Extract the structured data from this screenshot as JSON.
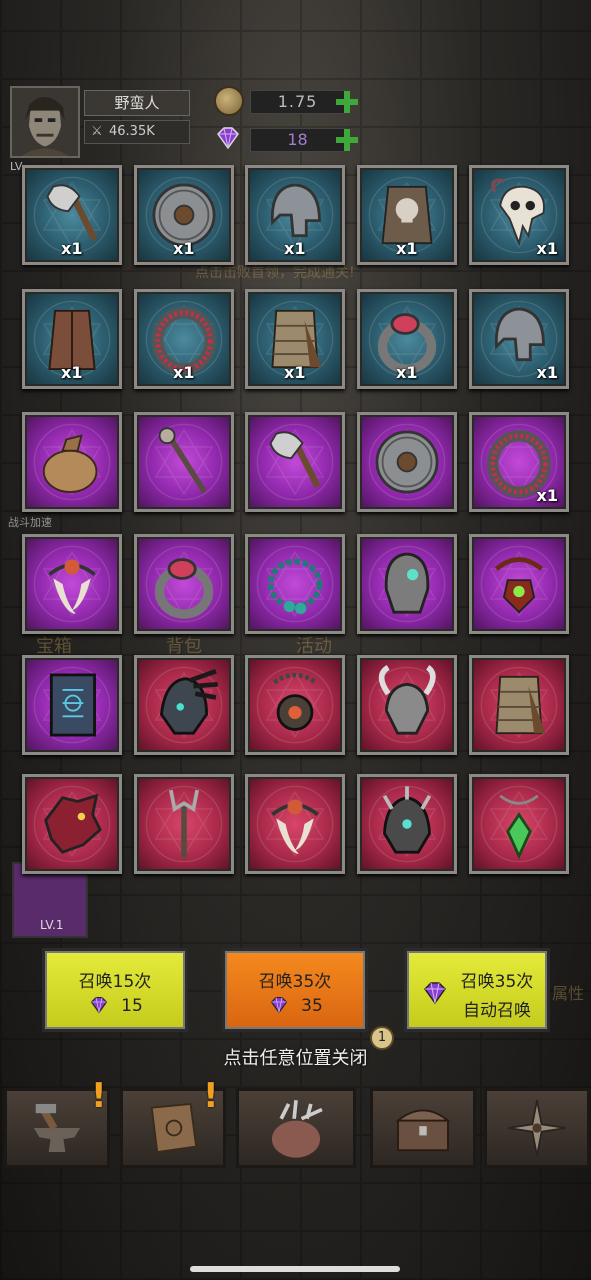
{
  "player": {
    "name": "野蛮人",
    "power": "46.35K",
    "level_prefix": "LV"
  },
  "currency": {
    "gold": "1.75",
    "gems": "18"
  },
  "background_text": {
    "hint": "点击击败首领，完成通关!",
    "tab1": "宝箱",
    "tab2": "背包",
    "tab3": "活动",
    "battle_speed": "战斗加速",
    "attr": "属性",
    "slot_level": "LV.1"
  },
  "items": [
    {
      "name": "axe",
      "rarity": "blue",
      "count": "x1"
    },
    {
      "name": "round-shield",
      "rarity": "blue",
      "count": "x1"
    },
    {
      "name": "iron-helmet",
      "rarity": "blue",
      "count": "x1"
    },
    {
      "name": "barbarian-chest-armor",
      "rarity": "blue",
      "count": "x1"
    },
    {
      "name": "skull-helmet",
      "rarity": "blue",
      "count": "x1"
    },
    {
      "name": "leather-vest",
      "rarity": "blue",
      "count": "x1"
    },
    {
      "name": "studded-ring",
      "rarity": "blue",
      "count": "x1"
    },
    {
      "name": "scale-armor",
      "rarity": "blue",
      "count": "x1"
    },
    {
      "name": "gem-ring",
      "rarity": "blue",
      "count": "x1"
    },
    {
      "name": "iron-helmet",
      "rarity": "blue",
      "count": "x1"
    },
    {
      "name": "loot-sack",
      "rarity": "purple",
      "count": ""
    },
    {
      "name": "staff",
      "rarity": "purple",
      "count": ""
    },
    {
      "name": "axe",
      "rarity": "purple",
      "count": ""
    },
    {
      "name": "round-shield",
      "rarity": "purple",
      "count": ""
    },
    {
      "name": "studded-ring",
      "rarity": "purple",
      "count": "x1"
    },
    {
      "name": "fang-necklace",
      "rarity": "purple",
      "count": ""
    },
    {
      "name": "gem-ring",
      "rarity": "purple",
      "count": ""
    },
    {
      "name": "bead-necklace",
      "rarity": "purple",
      "count": ""
    },
    {
      "name": "ornate-helmet",
      "rarity": "purple",
      "count": ""
    },
    {
      "name": "thorn-amulet",
      "rarity": "purple",
      "count": ""
    },
    {
      "name": "spell-book",
      "rarity": "purple",
      "count": ""
    },
    {
      "name": "feathered-helm",
      "rarity": "red",
      "count": ""
    },
    {
      "name": "chain-amulet",
      "rarity": "red",
      "count": ""
    },
    {
      "name": "horned-helmet",
      "rarity": "red",
      "count": ""
    },
    {
      "name": "scale-armor",
      "rarity": "red",
      "count": ""
    },
    {
      "name": "dragon-helm",
      "rarity": "red",
      "count": ""
    },
    {
      "name": "trident-staff",
      "rarity": "red",
      "count": ""
    },
    {
      "name": "fang-necklace",
      "rarity": "red",
      "count": ""
    },
    {
      "name": "spiked-helmet",
      "rarity": "red",
      "count": ""
    },
    {
      "name": "emerald-pendant",
      "rarity": "red",
      "count": ""
    }
  ],
  "summon": [
    {
      "label": "召唤15次",
      "cost": "15",
      "color": "yellow"
    },
    {
      "label": "召唤35次",
      "cost": "35",
      "color": "orange"
    },
    {
      "label": "召唤35次",
      "sub": "自动召唤",
      "color": "yellow"
    }
  ],
  "close_hint": "点击任意位置关闭",
  "badge": "1",
  "bottom_nav": [
    "anvil-icon",
    "book-icon",
    "pouch-icon",
    "chest-icon",
    "compass-icon"
  ],
  "colors": {
    "blue": "#2e6173",
    "purple": "#9129ad",
    "red": "#ab2a4b",
    "yellow": "#d8de2c",
    "orange": "#e87618",
    "plus": "#3fa83a"
  }
}
